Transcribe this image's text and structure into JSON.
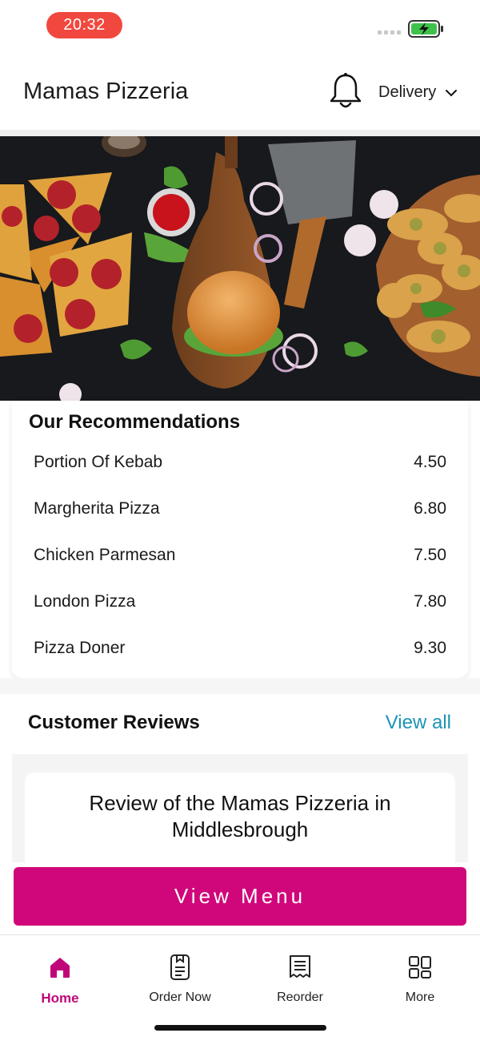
{
  "status": {
    "time": "20:32"
  },
  "header": {
    "title": "Mamas Pizzeria",
    "delivery_label": "Delivery"
  },
  "recommendations": {
    "title": "Our Recommendations",
    "items": [
      {
        "name": "Portion Of Kebab",
        "price": "4.50"
      },
      {
        "name": "Margherita Pizza",
        "price": "6.80"
      },
      {
        "name": "Chicken Parmesan",
        "price": "7.50"
      },
      {
        "name": "London Pizza",
        "price": "7.80"
      },
      {
        "name": "Pizza Doner",
        "price": "9.30"
      }
    ]
  },
  "reviews": {
    "title": "Customer Reviews",
    "view_all": "View all",
    "card_title": "Review of the Mamas Pizzeria in Middlesbrough"
  },
  "cta": {
    "label": "View Menu"
  },
  "nav": {
    "items": [
      {
        "label": "Home",
        "icon": "home-icon",
        "active": true
      },
      {
        "label": "Order Now",
        "icon": "order-icon",
        "active": false
      },
      {
        "label": "Reorder",
        "icon": "receipt-icon",
        "active": false
      },
      {
        "label": "More",
        "icon": "grid-icon",
        "active": false
      }
    ]
  },
  "colors": {
    "accent": "#d0077a",
    "link": "#1d94b6",
    "time_pill": "#f0483e"
  }
}
